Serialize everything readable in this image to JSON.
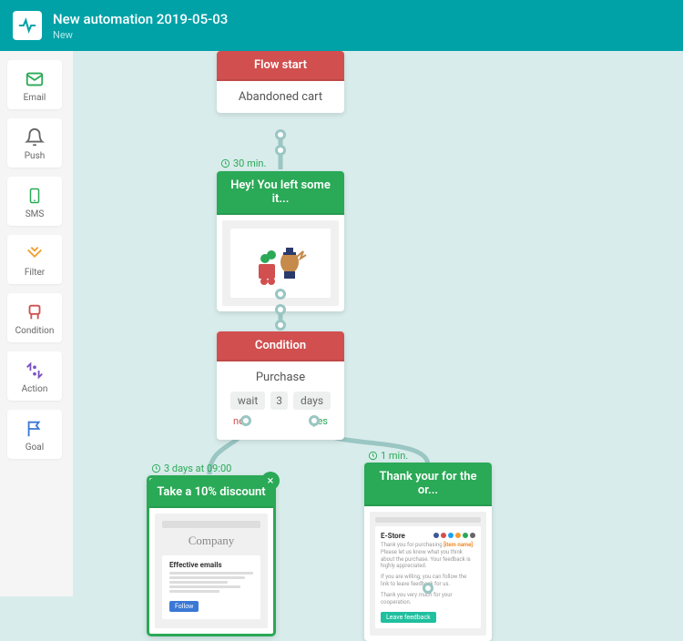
{
  "header": {
    "title": "New automation 2019-05-03",
    "status": "New"
  },
  "sidebar": {
    "items": [
      {
        "label": "Email"
      },
      {
        "label": "Push"
      },
      {
        "label": "SMS"
      },
      {
        "label": "Filter"
      },
      {
        "label": "Condition"
      },
      {
        "label": "Action"
      },
      {
        "label": "Goal"
      }
    ]
  },
  "nodes": {
    "start": {
      "header": "Flow start",
      "body": "Abandoned cart"
    },
    "email1": {
      "delay": "30 min.",
      "header": "Hey! You left some it..."
    },
    "condition": {
      "header": "Condition",
      "title": "Purchase",
      "wait_label": "wait",
      "wait_value": "3",
      "wait_unit": "days",
      "no_label": "no",
      "yes_label": "yes"
    },
    "discount": {
      "delay": "3 days at 09:00",
      "header": "Take a 10% discount",
      "preview_title": "Effective emails",
      "preview_btn": "Follow",
      "preview_brand": "Company"
    },
    "thankyou": {
      "delay": "1 min.",
      "header": "Thank your for the or...",
      "preview_store": "E-Store",
      "preview_btn": "Leave feedback"
    }
  }
}
